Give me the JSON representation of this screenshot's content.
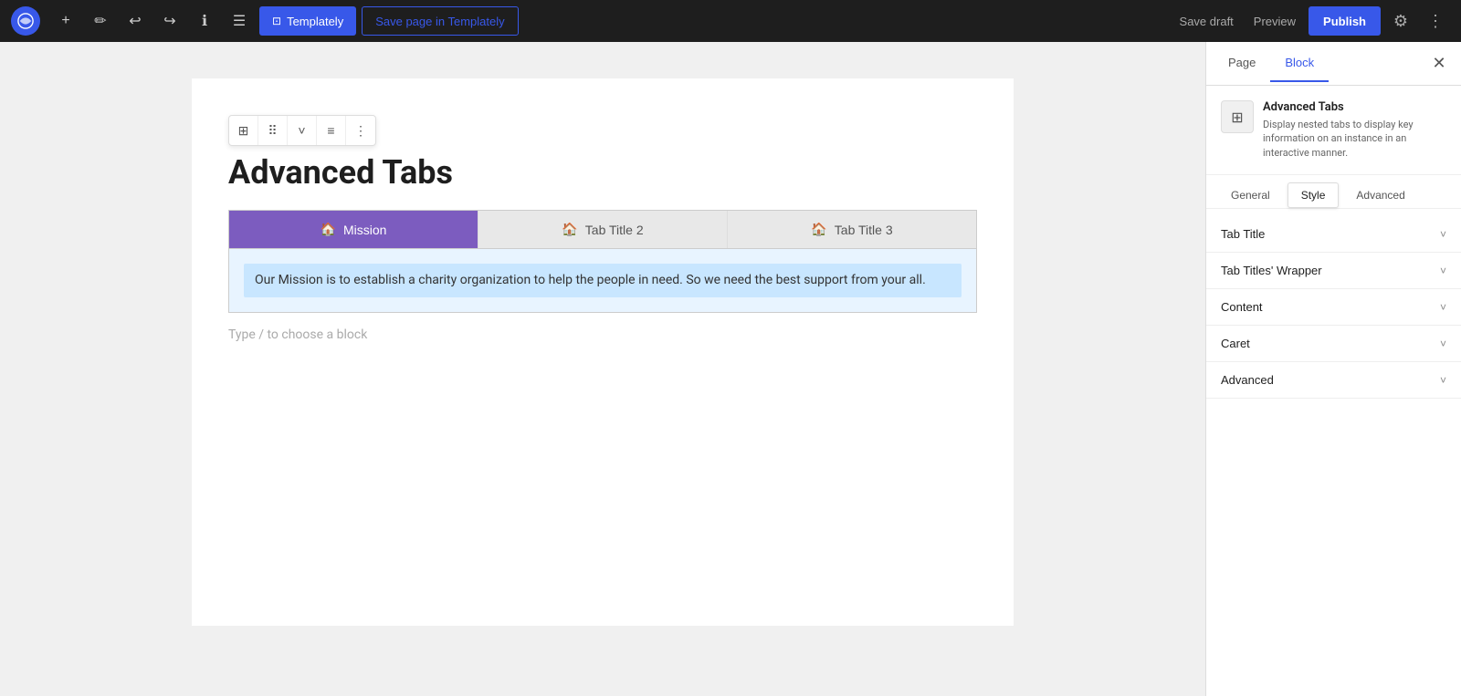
{
  "toolbar": {
    "add_label": "+",
    "edit_label": "✏",
    "undo_label": "↩",
    "redo_label": "↪",
    "info_label": "ℹ",
    "list_label": "☰",
    "templately_label": "Templately",
    "save_page_label": "Save page in Templately",
    "save_draft_label": "Save draft",
    "preview_label": "Preview",
    "publish_label": "Publish",
    "settings_label": "⚙",
    "more_label": "⋮"
  },
  "page": {
    "title": "Advanced Tabs"
  },
  "block_toolbar": {
    "grid_icon": "⊞",
    "dots_icon": "⠿",
    "chevron_icon": "˅",
    "align_icon": "≡",
    "more_icon": "⋮"
  },
  "tabs": {
    "items": [
      {
        "label": "Mission",
        "icon": "🏠",
        "active": true
      },
      {
        "label": "Tab Title 2",
        "icon": "🏠",
        "active": false
      },
      {
        "label": "Tab Title 3",
        "icon": "🏠",
        "active": false
      }
    ],
    "content": "Our Mission is to establish a charity organization to help the people in need. So we need the best support from your all."
  },
  "placeholder": "Type / to choose a block",
  "right_panel": {
    "tab_page": "Page",
    "tab_block": "Block",
    "block_name": "Advanced Tabs",
    "block_description": "Display nested tabs to display key information on an instance in an interactive manner.",
    "style_tabs": [
      "General",
      "Style",
      "Advanced"
    ],
    "active_style_tab": "Style",
    "accordion_items": [
      {
        "label": "Tab Title"
      },
      {
        "label": "Tab Titles' Wrapper"
      },
      {
        "label": "Content"
      },
      {
        "label": "Caret"
      },
      {
        "label": "Advanced"
      }
    ]
  },
  "colors": {
    "active_tab_bg": "#7c5cbf",
    "content_bg": "#d6eaf8",
    "accent_blue": "#3858e9",
    "block_icon_bg": "#f0f0f0"
  }
}
